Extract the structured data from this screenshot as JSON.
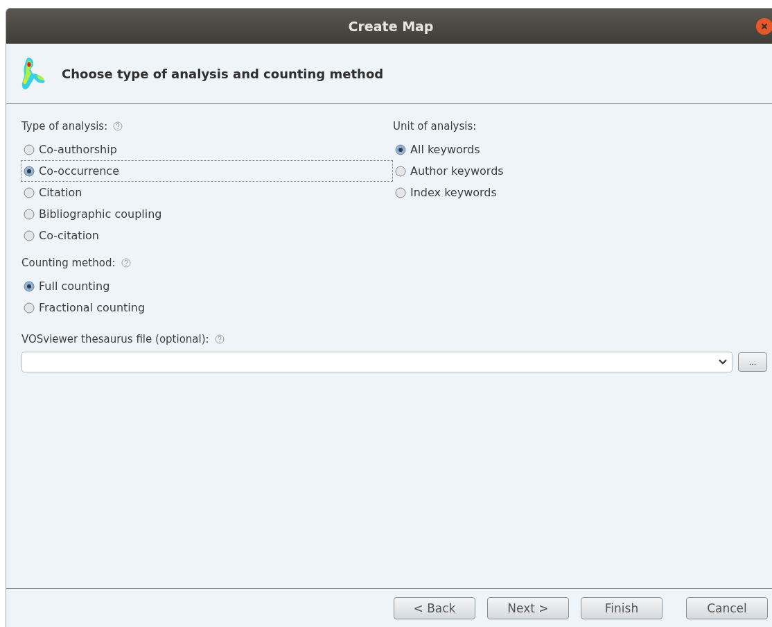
{
  "window": {
    "title": "Create Map"
  },
  "header": {
    "title": "Choose type of analysis and counting method"
  },
  "type_of_analysis": {
    "label": "Type of analysis:",
    "options": [
      {
        "label": "Co-authorship",
        "selected": false,
        "focused": false
      },
      {
        "label": "Co-occurrence",
        "selected": true,
        "focused": true
      },
      {
        "label": "Citation",
        "selected": false,
        "focused": false
      },
      {
        "label": "Bibliographic coupling",
        "selected": false,
        "focused": false
      },
      {
        "label": "Co-citation",
        "selected": false,
        "focused": false
      }
    ]
  },
  "unit_of_analysis": {
    "label": "Unit of analysis:",
    "options": [
      {
        "label": "All keywords",
        "selected": true
      },
      {
        "label": "Author keywords",
        "selected": false
      },
      {
        "label": "Index keywords",
        "selected": false
      }
    ]
  },
  "counting_method": {
    "label": "Counting method:",
    "options": [
      {
        "label": "Full counting",
        "selected": true
      },
      {
        "label": "Fractional counting",
        "selected": false
      }
    ]
  },
  "thesaurus": {
    "label": "VOSviewer thesaurus file (optional):",
    "browse_button": "..."
  },
  "buttons": [
    {
      "label": "< Back"
    },
    {
      "label": "Next >"
    },
    {
      "label": "Finish"
    },
    {
      "label": "Cancel"
    }
  ]
}
